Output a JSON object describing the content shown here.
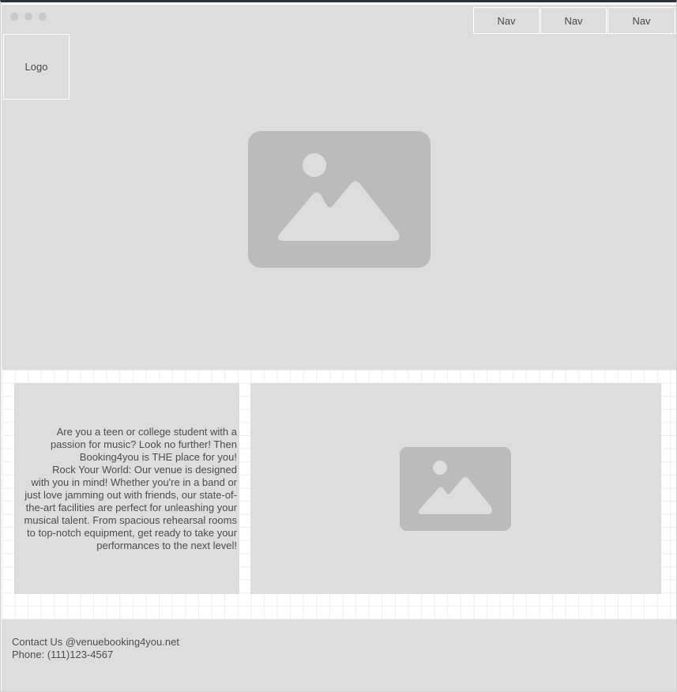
{
  "header": {
    "nav_items": [
      "Nav",
      "Nav",
      "Nav"
    ],
    "logo_label": "Logo"
  },
  "hero": {
    "image_icon": "image-placeholder-icon"
  },
  "content": {
    "text_lines": [
      "Are you a teen or college student with a",
      "passion for music? Look no further! Then",
      "Booking4you is THE place for you!",
      "Rock Your World: Our venue is designed",
      "with you in mind! Whether you're in a band or",
      "just love jamming out with friends, our state-of-",
      "the-art facilities are perfect for unleashing your",
      "musical talent. From spacious rehearsal rooms",
      "to top-notch equipment, get ready to take your",
      "performances to the next level!"
    ],
    "media_icon": "image-placeholder-icon"
  },
  "footer": {
    "contact": "Contact Us @venuebooking4you.net",
    "phone": "Phone: (111)123-4567"
  },
  "colors": {
    "panel": "#dddddd",
    "placeholder": "#bbbbbb",
    "text": "#4e4e4e"
  }
}
